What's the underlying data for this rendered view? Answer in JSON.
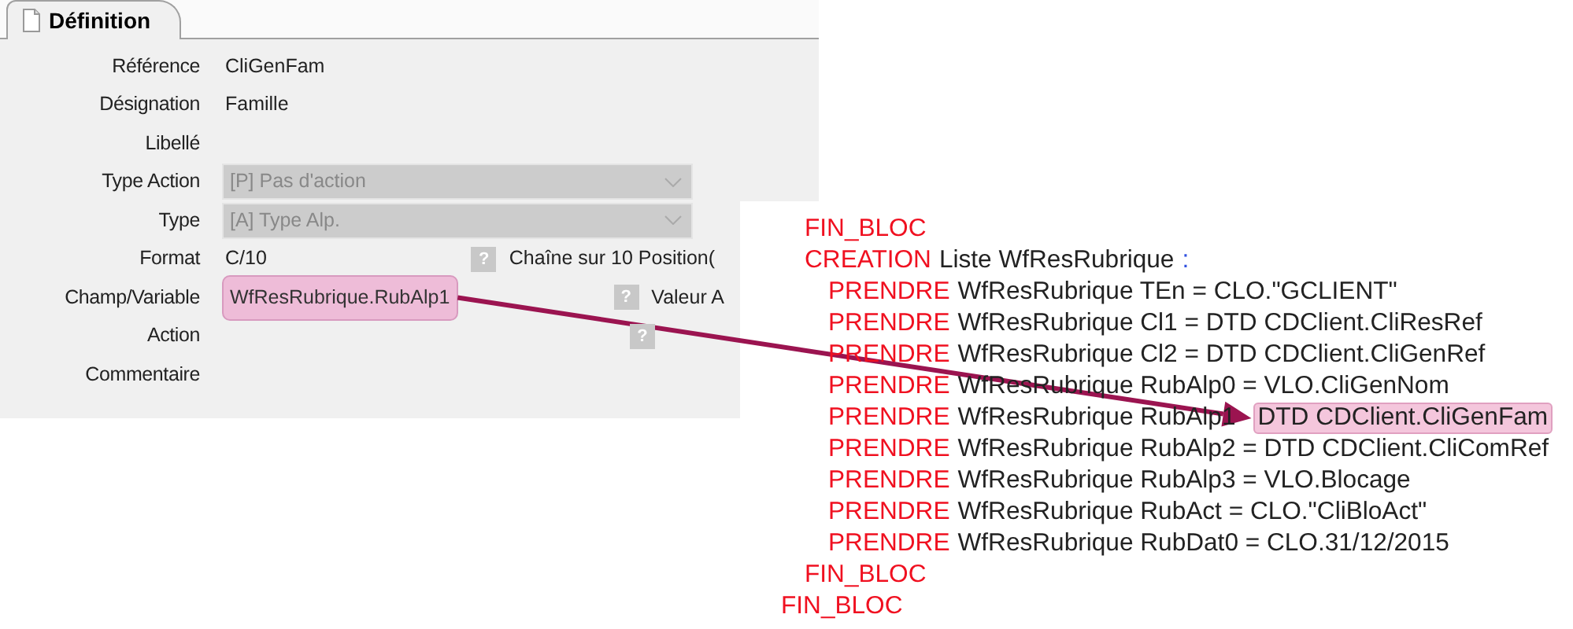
{
  "tab": {
    "label": "Définition",
    "selected": true
  },
  "fields": [
    {
      "label": "Référence",
      "kind": "text",
      "value": "CliGenFam"
    },
    {
      "label": "Désignation",
      "kind": "text",
      "value": "Famille"
    },
    {
      "label": "Libellé",
      "kind": "text"
    },
    {
      "label": "Type Action",
      "kind": "select",
      "value": "[P] Pas d'action",
      "disabled": true
    },
    {
      "label": "Type",
      "kind": "select",
      "value": "[A] Type Alp.",
      "disabled": true
    },
    {
      "label": "Format",
      "kind": "text",
      "value": "C/10",
      "help": "?",
      "note": "Chaîne sur 10 Position("
    },
    {
      "label": "Champ/Variable",
      "kind": "highlight",
      "value": "WfResRubrique.RubAlp1",
      "help": "?",
      "note": "Valeur A"
    },
    {
      "label": "Action",
      "kind": "text",
      "help": "?"
    },
    {
      "label": "Commentaire",
      "kind": "text"
    }
  ],
  "code": [
    {
      "children": [
        {
          "segments": [
            {
              "kind": "keyword",
              "text": "FIN_BLOC"
            }
          ]
        },
        {
          "segments": [
            {
              "kind": "keyword",
              "text": "CREATION"
            },
            {
              "kind": "plain",
              "text": "Liste WfResRubrique"
            },
            {
              "kind": "symbol",
              "text": ":"
            }
          ],
          "children": [
            {
              "segments": [
                {
                  "kind": "keyword",
                  "text": "PRENDRE"
                },
                {
                  "kind": "plain",
                  "text": "WfResRubrique TEn = CLO.\"GCLIENT\""
                }
              ]
            },
            {
              "segments": [
                {
                  "kind": "keyword",
                  "text": "PRENDRE"
                },
                {
                  "kind": "plain",
                  "text": "WfResRubrique Cl1 = DTD CDClient.CliResRef"
                }
              ]
            },
            {
              "segments": [
                {
                  "kind": "keyword",
                  "text": "PRENDRE"
                },
                {
                  "kind": "plain",
                  "text": "WfResRubrique Cl2 = DTD CDClient.CliGenRef"
                }
              ]
            },
            {
              "segments": [
                {
                  "kind": "keyword",
                  "text": "PRENDRE"
                },
                {
                  "kind": "plain",
                  "text": "WfResRubrique RubAlp0 = VLO.CliGenNom"
                }
              ]
            },
            {
              "segments": [
                {
                  "kind": "keyword",
                  "text": "PRENDRE"
                },
                {
                  "kind": "plain",
                  "text": "WfResRubrique RubAlp1"
                },
                {
                  "kind": "highlight",
                  "text": "DTD CDClient.CliGenFam"
                }
              ]
            },
            {
              "segments": [
                {
                  "kind": "keyword",
                  "text": "PRENDRE"
                },
                {
                  "kind": "plain",
                  "text": "WfResRubrique RubAlp2 = DTD CDClient.CliComRef"
                }
              ]
            },
            {
              "segments": [
                {
                  "kind": "keyword",
                  "text": "PRENDRE"
                },
                {
                  "kind": "plain",
                  "text": "WfResRubrique RubAlp3 = VLO.Blocage"
                }
              ]
            },
            {
              "segments": [
                {
                  "kind": "keyword",
                  "text": "PRENDRE"
                },
                {
                  "kind": "plain",
                  "text": "WfResRubrique RubAct = CLO.\"CliBloAct\""
                }
              ]
            },
            {
              "segments": [
                {
                  "kind": "keyword",
                  "text": "PRENDRE"
                },
                {
                  "kind": "plain",
                  "text": "WfResRubrique RubDat0 = CLO.31/12/2015"
                }
              ]
            }
          ]
        },
        {
          "segments": [
            {
              "kind": "keyword",
              "text": "FIN_BLOC"
            }
          ]
        }
      ]
    },
    {
      "segments": [
        {
          "kind": "keyword",
          "text": "FIN_BLOC"
        }
      ]
    }
  ]
}
